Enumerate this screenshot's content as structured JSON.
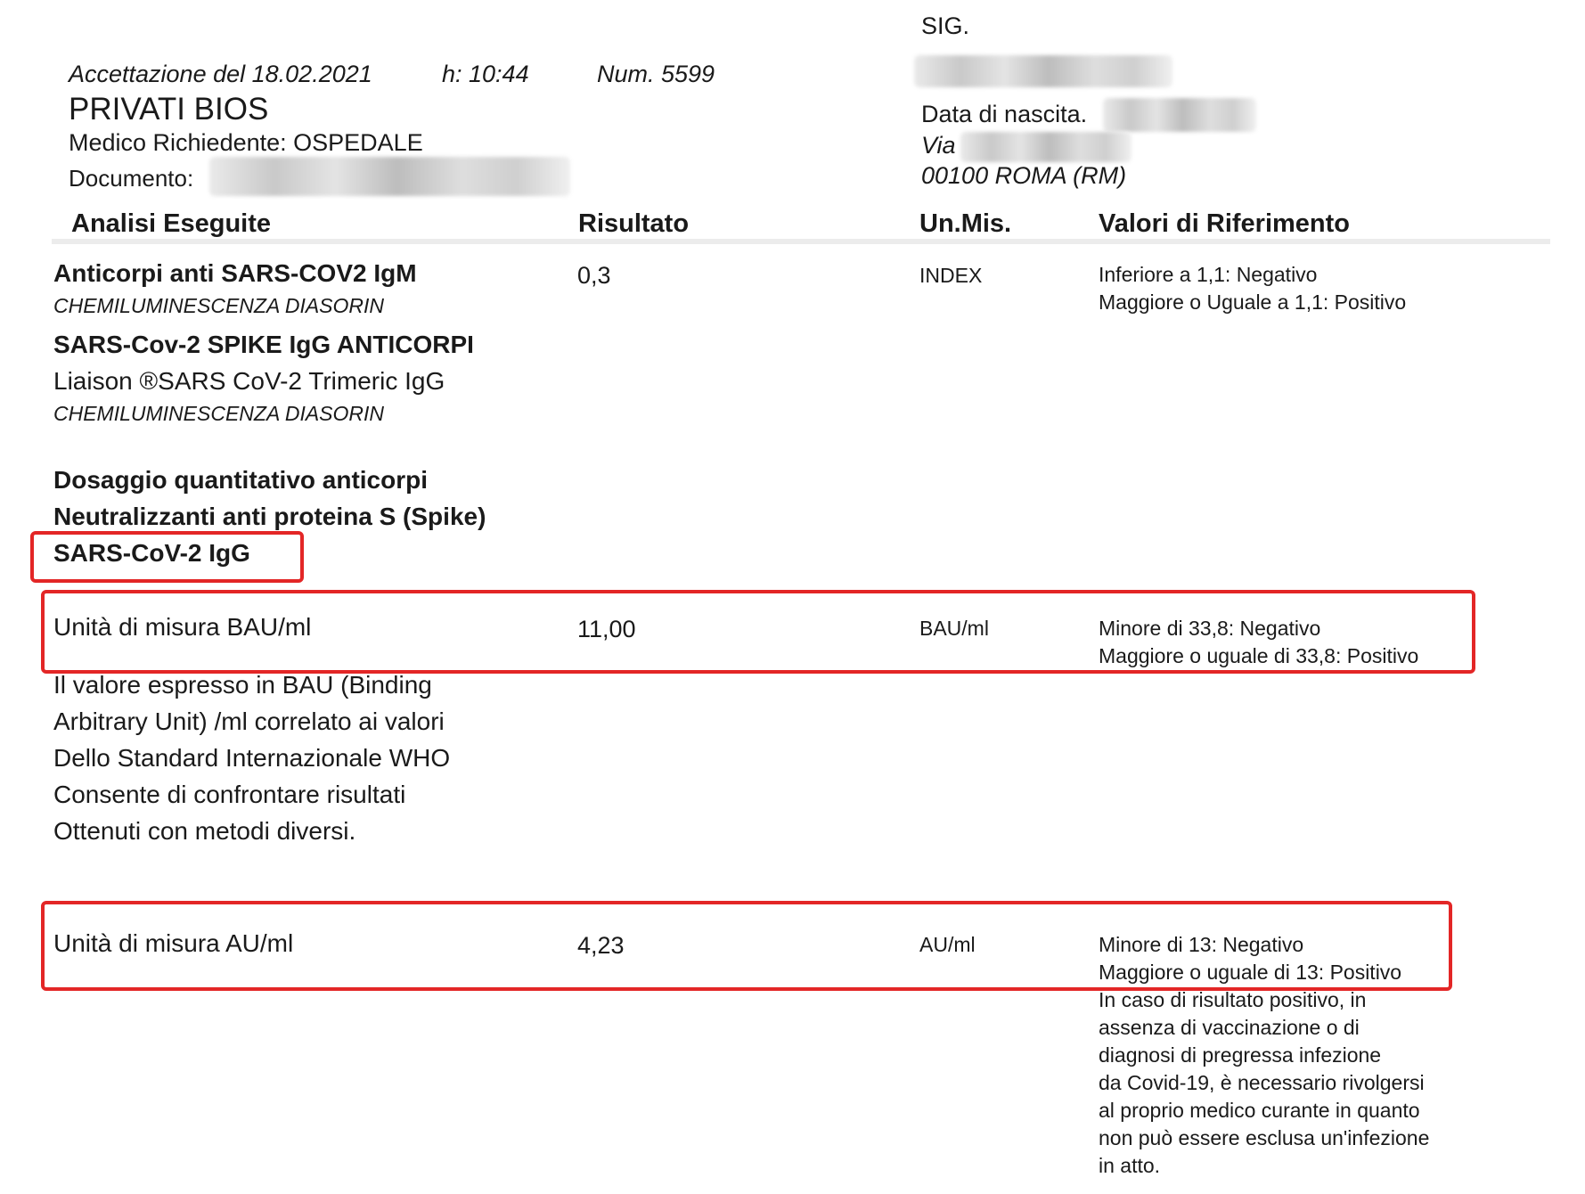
{
  "header": {
    "acceptance": "Accettazione del 18.02.2021",
    "hour": "h: 10:44",
    "number": "Num. 5599",
    "client": "PRIVATI BIOS",
    "doctor": "Medico Richiedente: OSPEDALE",
    "document_label": "Documento:",
    "title_prefix": "SIG.",
    "birth_label": "Data di nascita.",
    "street_label": "Via",
    "city": "00100 ROMA (RM)"
  },
  "columns": {
    "analysis": "Analisi Eseguite",
    "result": "Risultato",
    "unit": "Un.Mis.",
    "reference": "Valori di Riferimento"
  },
  "tests": {
    "igm": {
      "name": "Anticorpi anti SARS-COV2 IgM",
      "method": "CHEMILUMINESCENZA DIASORIN",
      "result": "0,3",
      "unit": "INDEX",
      "ref1": "Inferiore a 1,1: Negativo",
      "ref2": "Maggiore o Uguale a 1,1: Positivo"
    },
    "spike": {
      "name": "SARS-Cov-2 SPIKE IgG ANTICORPI",
      "kit": "Liaison ®SARS CoV-2 Trimeric IgG",
      "method": "CHEMILUMINESCENZA DIASORIN"
    },
    "neutral": {
      "line1": "Dosaggio quantitativo anticorpi",
      "line2": "Neutralizzanti anti proteina S (Spike)",
      "line3": "SARS-CoV-2 IgG"
    },
    "bau": {
      "label": "Unità di misura BAU/ml",
      "result": "11,00",
      "unit": "BAU/ml",
      "ref1": "Minore di 33,8: Negativo",
      "ref2": "Maggiore o uguale di 33,8: Positivo"
    },
    "note": {
      "l1": "Il valore espresso in BAU (Binding",
      "l2": "Arbitrary Unit) /ml correlato ai valori",
      "l3": "Dello Standard Internazionale WHO",
      "l4": "Consente di confrontare risultati",
      "l5": "Ottenuti con metodi diversi."
    },
    "au": {
      "label": "Unità di misura AU/ml",
      "result": "4,23",
      "unit": "AU/ml",
      "ref1": "Minore di 13: Negativo",
      "ref2": "Maggiore o uguale di 13: Positivo",
      "ref3": "In caso di risultato positivo, in",
      "ref4": "assenza di vaccinazione o di",
      "ref5": "diagnosi di pregressa infezione",
      "ref6": "da Covid-19, è necessario rivolgersi",
      "ref7": "al proprio medico curante in quanto",
      "ref8": "non può essere esclusa un'infezione",
      "ref9": "in atto."
    }
  }
}
